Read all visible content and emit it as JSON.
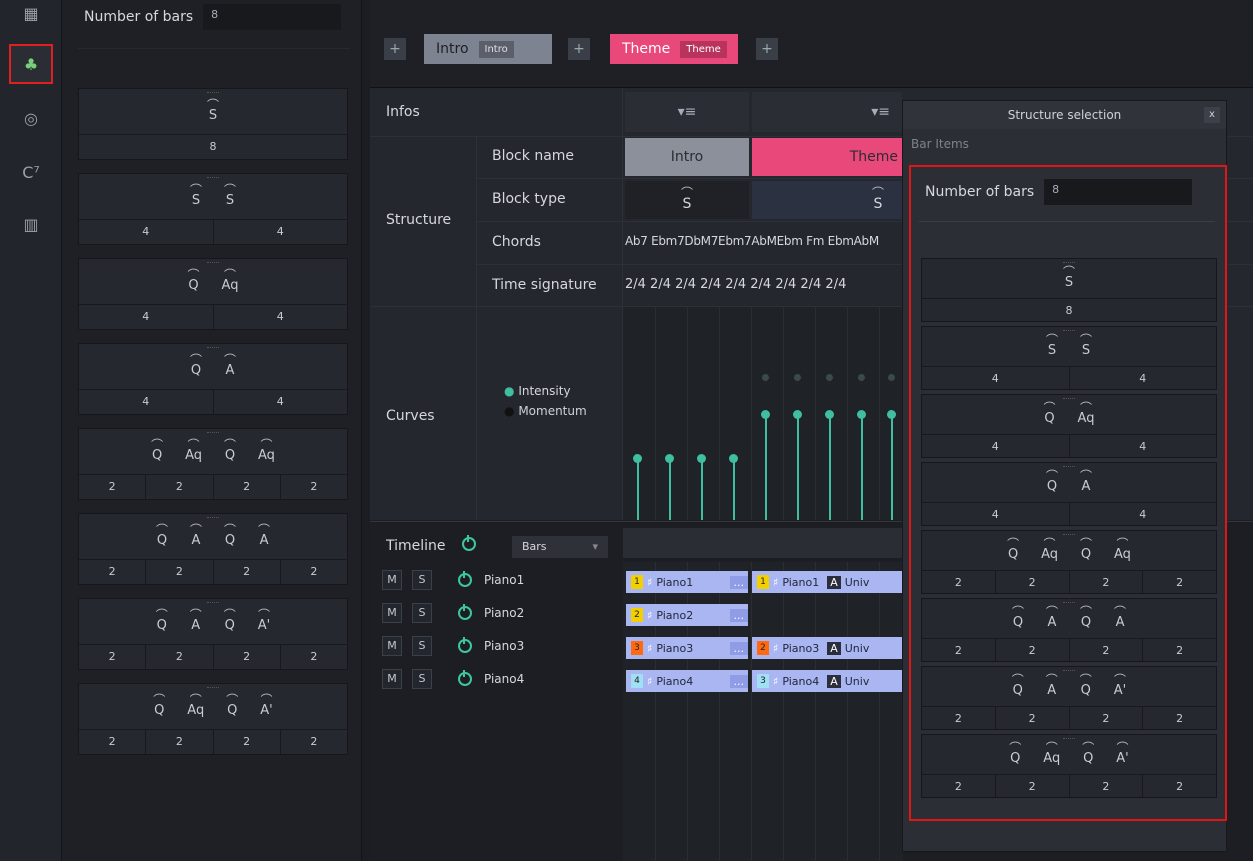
{
  "rail": {
    "icons": [
      "grid-icon",
      "structure-icon",
      "wheel-icon",
      "chord-icon",
      "piano-icon"
    ]
  },
  "left_panel": {
    "num_bars_label": "Number of bars",
    "num_bars_value": "8",
    "cards": [
      {
        "symbols": [
          "S"
        ],
        "counts": [
          "8"
        ]
      },
      {
        "symbols": [
          "S",
          "S"
        ],
        "counts": [
          "4",
          "4"
        ]
      },
      {
        "symbols": [
          "Q",
          "Aq"
        ],
        "counts": [
          "4",
          "4"
        ]
      },
      {
        "symbols": [
          "Q",
          "A"
        ],
        "counts": [
          "4",
          "4"
        ]
      },
      {
        "symbols": [
          "Q",
          "Aq",
          "Q",
          "Aq"
        ],
        "counts": [
          "2",
          "2",
          "2",
          "2"
        ]
      },
      {
        "symbols": [
          "Q",
          "A",
          "Q",
          "A"
        ],
        "counts": [
          "2",
          "2",
          "2",
          "2"
        ]
      },
      {
        "symbols": [
          "Q",
          "A",
          "Q",
          "A'"
        ],
        "counts": [
          "2",
          "2",
          "2",
          "2"
        ]
      },
      {
        "symbols": [
          "Q",
          "Aq",
          "Q",
          "A'"
        ],
        "counts": [
          "2",
          "2",
          "2",
          "2"
        ]
      }
    ]
  },
  "topbar": {
    "plus": "+",
    "intro_label": "Intro",
    "intro_inner": "Intro",
    "theme_label": "Theme",
    "theme_inner": "Theme"
  },
  "grid": {
    "infos": "Infos",
    "structure": "Structure",
    "block_name": "Block name",
    "block_type": "Block type",
    "chords_label": "Chords",
    "time_sig_label": "Time signature",
    "curves": "Curves",
    "intensity": "Intensity",
    "momentum": "Momentum",
    "intro_name": "Intro",
    "theme_name": "Theme",
    "block_type_intro": "S",
    "block_type_theme": "S",
    "chords_text": "Ab7 Ebm7DbM7Ebm7AbMEbm Fm EbmAbM",
    "time_sig_text": "2/4 2/4 2/4 2/4 2/4 2/4 2/4 2/4 2/4"
  },
  "timeline": {
    "label": "Timeline",
    "mode": "Bars",
    "tracks": [
      {
        "name": "Piano1",
        "m": "M",
        "s": "S"
      },
      {
        "name": "Piano2",
        "m": "M",
        "s": "S"
      },
      {
        "name": "Piano3",
        "m": "M",
        "s": "S"
      },
      {
        "name": "Piano4",
        "m": "M",
        "s": "S"
      }
    ],
    "clips": {
      "c1": {
        "num": "1",
        "name": "Piano1",
        "more": "..."
      },
      "c2": {
        "num": "1",
        "name": "Piano1",
        "tag": "A",
        "extra": "Univ"
      },
      "c3": {
        "num": "2",
        "name": "Piano2",
        "more": "..."
      },
      "c4": {
        "num": "3",
        "name": "Piano3",
        "more": "..."
      },
      "c5": {
        "num": "2",
        "name": "Piano3",
        "tag": "A",
        "extra": "Univ"
      },
      "c6": {
        "num": "4",
        "name": "Piano4",
        "more": "..."
      },
      "c7": {
        "num": "3",
        "name": "Piano4",
        "tag": "A",
        "extra": "Univ"
      }
    }
  },
  "popup": {
    "title": "Structure selection",
    "close": "x",
    "bar_items": "Bar Items",
    "num_bars_label": "Number of bars",
    "num_bars_value": "8",
    "cards": [
      {
        "symbols": [
          "S"
        ],
        "counts": [
          "8"
        ]
      },
      {
        "symbols": [
          "S",
          "S"
        ],
        "counts": [
          "4",
          "4"
        ]
      },
      {
        "symbols": [
          "Q",
          "Aq"
        ],
        "counts": [
          "4",
          "4"
        ]
      },
      {
        "symbols": [
          "Q",
          "A"
        ],
        "counts": [
          "4",
          "4"
        ]
      },
      {
        "symbols": [
          "Q",
          "Aq",
          "Q",
          "Aq"
        ],
        "counts": [
          "2",
          "2",
          "2",
          "2"
        ]
      },
      {
        "symbols": [
          "Q",
          "A",
          "Q",
          "A"
        ],
        "counts": [
          "2",
          "2",
          "2",
          "2"
        ]
      },
      {
        "symbols": [
          "Q",
          "A",
          "Q",
          "A'"
        ],
        "counts": [
          "2",
          "2",
          "2",
          "2"
        ]
      },
      {
        "symbols": [
          "Q",
          "Aq",
          "Q",
          "A'"
        ],
        "counts": [
          "2",
          "2",
          "2",
          "2"
        ]
      }
    ]
  },
  "colors": {
    "accent_pink": "#e8497a",
    "accent_green": "#3fbfa0",
    "highlight_red": "#e01515",
    "clip_blue": "#a9b6f2"
  }
}
